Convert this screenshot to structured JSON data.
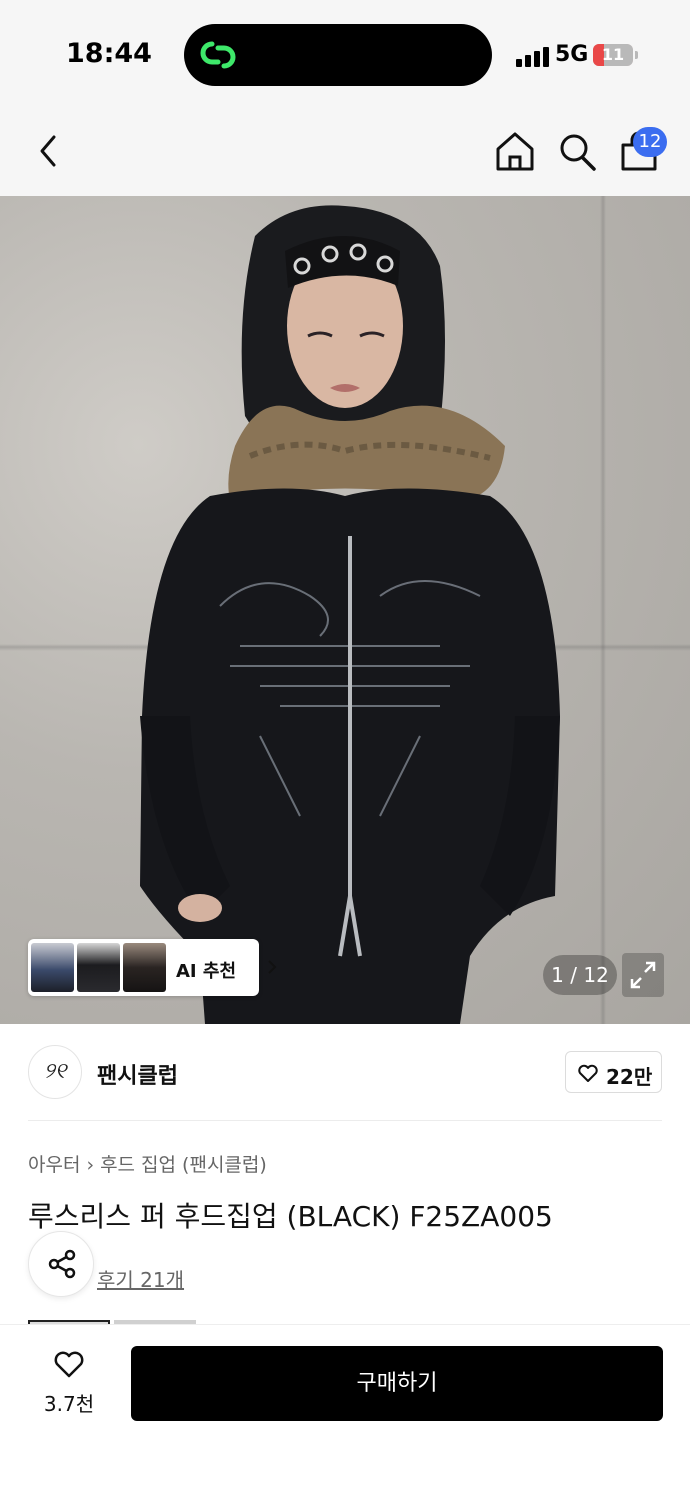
{
  "status_bar": {
    "time": "18:44",
    "network": "5G",
    "battery": "11"
  },
  "nav": {
    "cart_badge": "12"
  },
  "gallery": {
    "ai_label": "AI 추천",
    "counter": "1 / 12"
  },
  "brand": {
    "logo_glyph": "୨୧",
    "name": "팬시클럽",
    "likes": "22만"
  },
  "product": {
    "breadcrumb": [
      "아우터",
      "후드 집업 (팬시클럽)"
    ],
    "title": "루스리스 퍼 후드집업 (BLACK) F25ZA005",
    "review_link": "후기 21개"
  },
  "bottom_bar": {
    "wish_count": "3.7천",
    "buy_label": "구매하기"
  },
  "colors": {
    "badge": "#3b6df0",
    "primary_button": "#000000",
    "battery_low": "#e94848"
  }
}
